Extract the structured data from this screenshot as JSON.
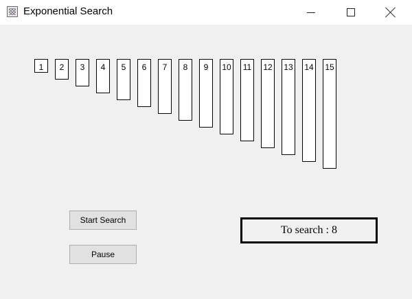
{
  "window": {
    "title": "Exponential Search",
    "controls": [
      "minimize",
      "maximize",
      "close"
    ]
  },
  "array": [
    1,
    2,
    3,
    4,
    5,
    6,
    7,
    8,
    9,
    10,
    11,
    12,
    13,
    14,
    15
  ],
  "buttons": {
    "start_label": "Start Search",
    "pause_label": "Pause"
  },
  "search": {
    "text": "To search : 8"
  }
}
